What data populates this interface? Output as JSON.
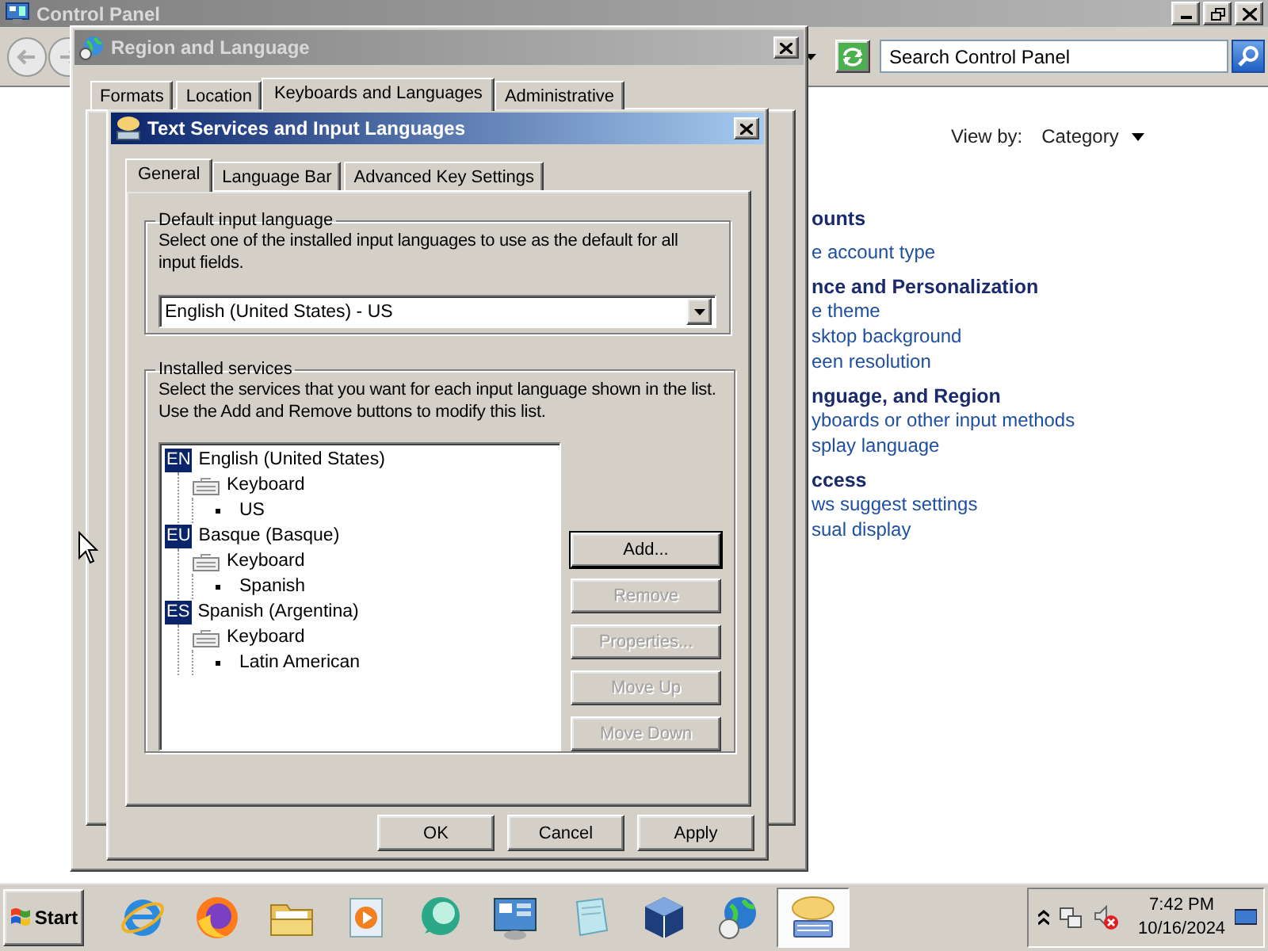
{
  "control_panel": {
    "title": "Control Panel",
    "search": {
      "placeholder": "Search Control Panel"
    },
    "view_by": {
      "label": "View by:",
      "value": "Category"
    },
    "categories": [
      {
        "title": "ounts",
        "links": [
          "e account type"
        ]
      },
      {
        "title": "nce and Personalization",
        "links": [
          "e theme",
          "sktop background",
          "een resolution"
        ]
      },
      {
        "title": "nguage, and Region",
        "links": [
          "yboards or other input methods",
          "splay language"
        ]
      },
      {
        "title": "ccess",
        "links": [
          "ws suggest settings",
          "sual display"
        ]
      }
    ]
  },
  "region_dialog": {
    "title": "Region and Language",
    "tabs": [
      {
        "label": "Formats",
        "selected": false
      },
      {
        "label": "Location",
        "selected": false
      },
      {
        "label": "Keyboards and Languages",
        "selected": true
      },
      {
        "label": "Administrative",
        "selected": false
      }
    ]
  },
  "text_services_dialog": {
    "title": "Text Services and Input Languages",
    "tabs": [
      {
        "label": "General",
        "selected": true
      },
      {
        "label": "Language Bar",
        "selected": false
      },
      {
        "label": "Advanced Key Settings",
        "selected": false
      }
    ],
    "default_language": {
      "legend": "Default input language",
      "description": "Select one of the installed input languages to use as the default for all input fields.",
      "dropdown": {
        "value": "English (United States) - US"
      }
    },
    "installed_services": {
      "legend": "Installed services",
      "description": "Select the services that you want for each input language shown in the list. Use the Add and Remove buttons to modify this list.",
      "tree": [
        {
          "kind": "language",
          "code": "EN",
          "label": "English (United States)",
          "children": [
            {
              "kind": "service",
              "label": "Keyboard",
              "children": [
                {
                  "kind": "layout",
                  "label": "US"
                }
              ]
            }
          ]
        },
        {
          "kind": "language",
          "code": "EU",
          "label": "Basque (Basque)",
          "children": [
            {
              "kind": "service",
              "label": "Keyboard",
              "children": [
                {
                  "kind": "layout",
                  "label": "Spanish"
                }
              ]
            }
          ]
        },
        {
          "kind": "language",
          "code": "ES",
          "label": "Spanish (Argentina)",
          "children": [
            {
              "kind": "service",
              "label": "Keyboard",
              "children": [
                {
                  "kind": "layout",
                  "label": "Latin American"
                }
              ]
            }
          ]
        }
      ],
      "buttons": [
        {
          "label": "Add...",
          "disabled": false,
          "focused": true
        },
        {
          "label": "Remove",
          "disabled": true,
          "focused": false
        },
        {
          "label": "Properties...",
          "disabled": true,
          "focused": false
        },
        {
          "label": "Move Up",
          "disabled": true,
          "focused": false
        },
        {
          "label": "Move Down",
          "disabled": true,
          "focused": false
        }
      ]
    },
    "footer_buttons": [
      "OK",
      "Cancel",
      "Apply"
    ]
  },
  "taskbar": {
    "start": "Start",
    "apps": [
      {
        "kind": "browser",
        "selected": false
      },
      {
        "kind": "fox",
        "selected": false
      },
      {
        "kind": "folder",
        "selected": false
      },
      {
        "kind": "media",
        "selected": false
      },
      {
        "kind": "chat",
        "selected": false
      },
      {
        "kind": "panel",
        "selected": false
      },
      {
        "kind": "notepad",
        "selected": false
      },
      {
        "kind": "cube",
        "selected": false
      },
      {
        "kind": "globe",
        "selected": false
      },
      {
        "kind": "keyboard",
        "selected": true
      }
    ],
    "clock": {
      "time": "7:42 PM",
      "date": "10/16/2024"
    }
  }
}
